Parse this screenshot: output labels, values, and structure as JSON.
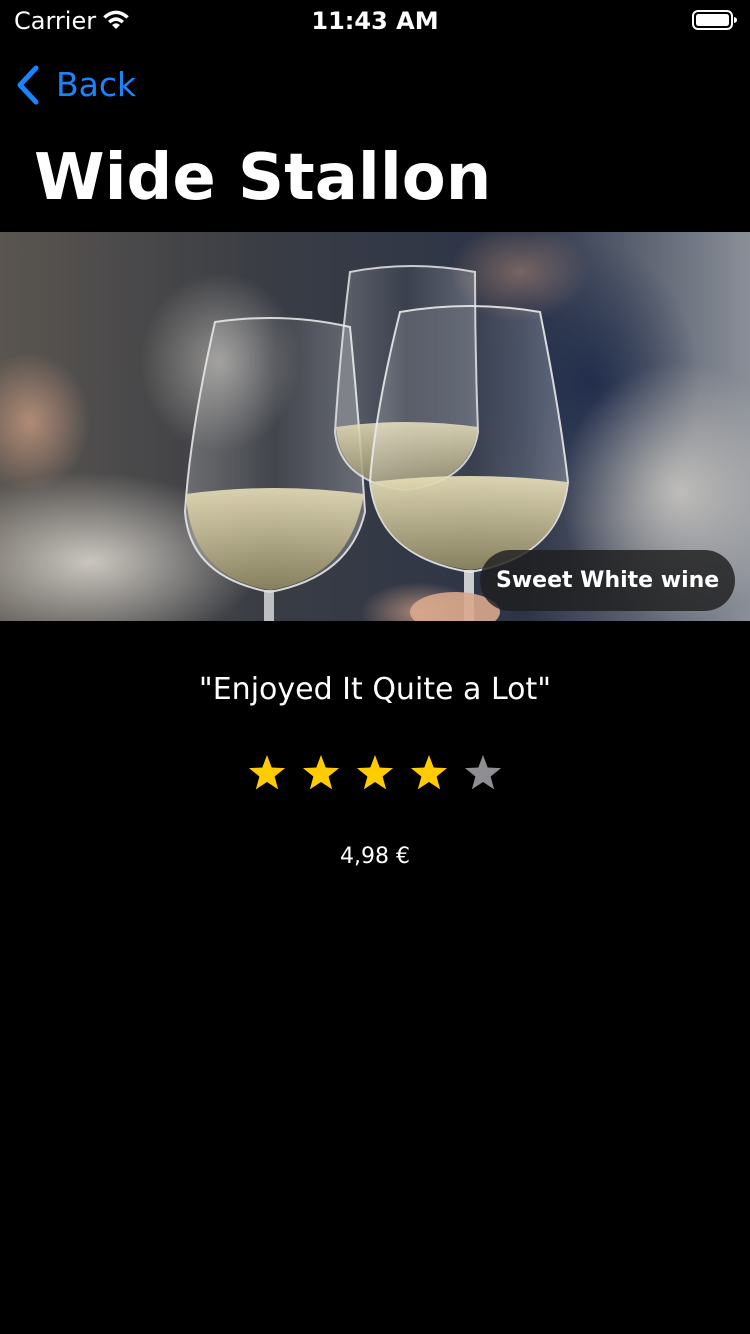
{
  "status_bar": {
    "carrier": "Carrier",
    "time": "11:43 AM",
    "icons": [
      "wifi-icon",
      "battery-icon"
    ]
  },
  "nav": {
    "back_label": "Back",
    "back_icon": "chevron-left-icon",
    "title": "Wide Stallon"
  },
  "hero": {
    "image_subject": "three glasses of white wine clinking",
    "badge": "Sweet White wine"
  },
  "review": {
    "quote": "\"Enjoyed It Quite a Lot\"",
    "rating": 4,
    "rating_max": 5
  },
  "price": "4,98 €",
  "colors": {
    "background": "#000000",
    "accent": "#1a84ff",
    "star_filled": "#ffcc00",
    "star_empty": "#8e8e93"
  }
}
